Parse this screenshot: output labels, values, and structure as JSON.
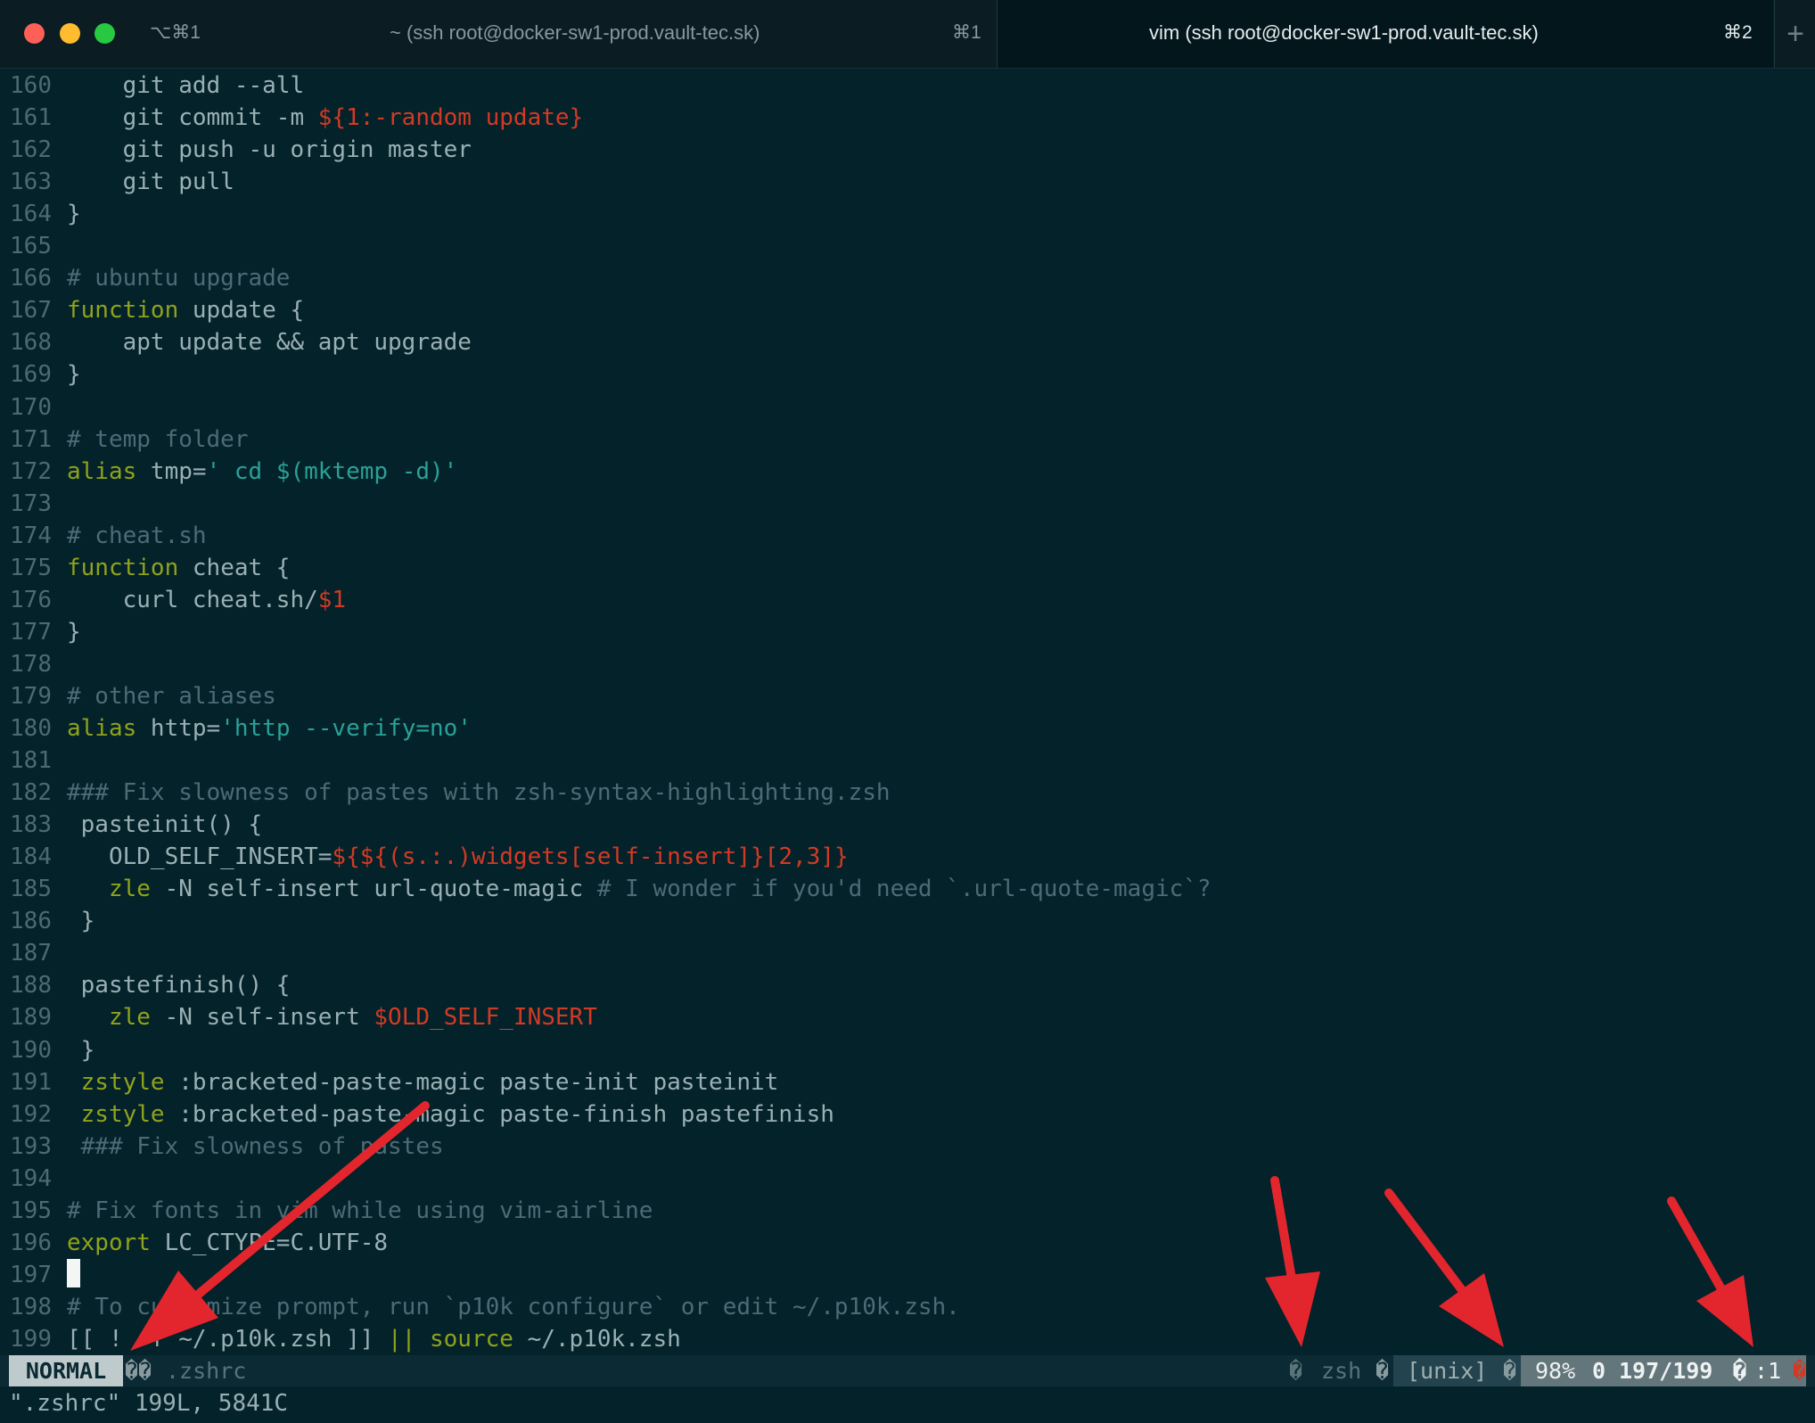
{
  "window": {
    "hotkey": "⌥⌘1"
  },
  "tabs": [
    {
      "title": "~ (ssh root@docker-sw1-prod.vault-tec.sk)",
      "shortcut": "⌘1"
    },
    {
      "title": "vim (ssh root@docker-sw1-prod.vault-tec.sk)",
      "shortcut": "⌘2"
    }
  ],
  "new_tab_icon": "+",
  "editor": {
    "lines": [
      {
        "num": "160",
        "segs": [
          {
            "t": "    git add --all",
            "c": "normal"
          }
        ]
      },
      {
        "num": "161",
        "segs": [
          {
            "t": "    git commit -m ",
            "c": "normal"
          },
          {
            "t": "${1:-random update}",
            "c": "var"
          }
        ]
      },
      {
        "num": "162",
        "segs": [
          {
            "t": "    git push -u origin master",
            "c": "normal"
          }
        ]
      },
      {
        "num": "163",
        "segs": [
          {
            "t": "    git pull",
            "c": "normal"
          }
        ]
      },
      {
        "num": "164",
        "segs": [
          {
            "t": "}",
            "c": "normal"
          }
        ]
      },
      {
        "num": "165",
        "segs": []
      },
      {
        "num": "166",
        "segs": [
          {
            "t": "# ubuntu upgrade",
            "c": "comment"
          }
        ]
      },
      {
        "num": "167",
        "segs": [
          {
            "t": "function",
            "c": "keyword"
          },
          {
            "t": " update {",
            "c": "normal"
          }
        ]
      },
      {
        "num": "168",
        "segs": [
          {
            "t": "    apt update && apt upgrade",
            "c": "normal"
          }
        ]
      },
      {
        "num": "169",
        "segs": [
          {
            "t": "}",
            "c": "normal"
          }
        ]
      },
      {
        "num": "170",
        "segs": []
      },
      {
        "num": "171",
        "segs": [
          {
            "t": "# temp folder",
            "c": "comment"
          }
        ]
      },
      {
        "num": "172",
        "segs": [
          {
            "t": "alias",
            "c": "keyword"
          },
          {
            "t": " tmp=",
            "c": "normal"
          },
          {
            "t": "' cd $(mktemp -d)'",
            "c": "string"
          }
        ]
      },
      {
        "num": "173",
        "segs": []
      },
      {
        "num": "174",
        "segs": [
          {
            "t": "# cheat.sh",
            "c": "comment"
          }
        ]
      },
      {
        "num": "175",
        "segs": [
          {
            "t": "function",
            "c": "keyword"
          },
          {
            "t": " cheat {",
            "c": "normal"
          }
        ]
      },
      {
        "num": "176",
        "segs": [
          {
            "t": "    curl cheat.sh/",
            "c": "normal"
          },
          {
            "t": "$1",
            "c": "var"
          }
        ]
      },
      {
        "num": "177",
        "segs": [
          {
            "t": "}",
            "c": "normal"
          }
        ]
      },
      {
        "num": "178",
        "segs": []
      },
      {
        "num": "179",
        "segs": [
          {
            "t": "# other aliases",
            "c": "comment"
          }
        ]
      },
      {
        "num": "180",
        "segs": [
          {
            "t": "alias",
            "c": "keyword"
          },
          {
            "t": " http=",
            "c": "normal"
          },
          {
            "t": "'http --verify=no'",
            "c": "string"
          }
        ]
      },
      {
        "num": "181",
        "segs": []
      },
      {
        "num": "182",
        "segs": [
          {
            "t": "### Fix slowness of pastes with zsh-syntax-highlighting.zsh",
            "c": "comment"
          }
        ]
      },
      {
        "num": "183",
        "segs": [
          {
            "t": " pasteinit() {",
            "c": "normal"
          }
        ]
      },
      {
        "num": "184",
        "segs": [
          {
            "t": "   OLD_SELF_INSERT=",
            "c": "normal"
          },
          {
            "t": "${${(s.:.)widgets[self-insert]}[2,3]}",
            "c": "var"
          }
        ]
      },
      {
        "num": "185",
        "segs": [
          {
            "t": "   ",
            "c": "normal"
          },
          {
            "t": "zle",
            "c": "keyword"
          },
          {
            "t": " -N self-insert url-quote-magic ",
            "c": "normal"
          },
          {
            "t": "# I wonder if you'd need `.url-quote-magic`?",
            "c": "comment"
          }
        ]
      },
      {
        "num": "186",
        "segs": [
          {
            "t": " }",
            "c": "normal"
          }
        ]
      },
      {
        "num": "187",
        "segs": []
      },
      {
        "num": "188",
        "segs": [
          {
            "t": " pastefinish() {",
            "c": "normal"
          }
        ]
      },
      {
        "num": "189",
        "segs": [
          {
            "t": "   ",
            "c": "normal"
          },
          {
            "t": "zle",
            "c": "keyword"
          },
          {
            "t": " -N self-insert ",
            "c": "normal"
          },
          {
            "t": "$OLD_SELF_INSERT",
            "c": "var"
          }
        ]
      },
      {
        "num": "190",
        "segs": [
          {
            "t": " }",
            "c": "normal"
          }
        ]
      },
      {
        "num": "191",
        "segs": [
          {
            "t": " ",
            "c": "normal"
          },
          {
            "t": "zstyle",
            "c": "keyword"
          },
          {
            "t": " :bracketed-paste-magic paste-init pasteinit",
            "c": "normal"
          }
        ]
      },
      {
        "num": "192",
        "segs": [
          {
            "t": " ",
            "c": "normal"
          },
          {
            "t": "zstyle",
            "c": "keyword"
          },
          {
            "t": " :bracketed-paste-magic paste-finish pastefinish",
            "c": "normal"
          }
        ]
      },
      {
        "num": "193",
        "segs": [
          {
            "t": " ### Fix slowness of pastes",
            "c": "comment"
          }
        ]
      },
      {
        "num": "194",
        "segs": []
      },
      {
        "num": "195",
        "segs": [
          {
            "t": "# Fix fonts in vim while using vim-airline",
            "c": "comment"
          }
        ]
      },
      {
        "num": "196",
        "segs": [
          {
            "t": "export",
            "c": "keyword"
          },
          {
            "t": " LC_CTYPE=C.UTF-8",
            "c": "normal"
          }
        ]
      },
      {
        "num": "197",
        "segs": [],
        "cursor": true
      },
      {
        "num": "198",
        "segs": [
          {
            "t": "# To customize prompt, run `p10k configure` or edit ~/.p10k.zsh.",
            "c": "comment"
          }
        ]
      },
      {
        "num": "199",
        "segs": [
          {
            "t": "[[ ! -f ~/.p10k.zsh ]] ",
            "c": "normal"
          },
          {
            "t": "||",
            "c": "keyword"
          },
          {
            "t": " ",
            "c": "normal"
          },
          {
            "t": "source",
            "c": "keyword"
          },
          {
            "t": " ~/.p10k.zsh",
            "c": "normal"
          }
        ]
      }
    ]
  },
  "statusline": {
    "mode": "NORMAL",
    "left_separator": "��",
    "filename": ".zshrc",
    "filetype_separator": "�",
    "filetype": "zsh",
    "encoding_separator": "�",
    "fileformat": "[unix]",
    "fileformat_separator": "�",
    "percent": "98%",
    "line_symbol": "0",
    "position": "197/199",
    "column_symbol": "�",
    "column": ":1",
    "warning_mark": "�"
  },
  "cmdline": "\".zshrc\" 199L, 5841C",
  "colors": {
    "background": "#04222a",
    "comment": "#4c6b74",
    "keyword": "#8fa31b",
    "string": "#2aa198",
    "variable": "#d23a24",
    "annotation_arrow": "#e3262d"
  }
}
